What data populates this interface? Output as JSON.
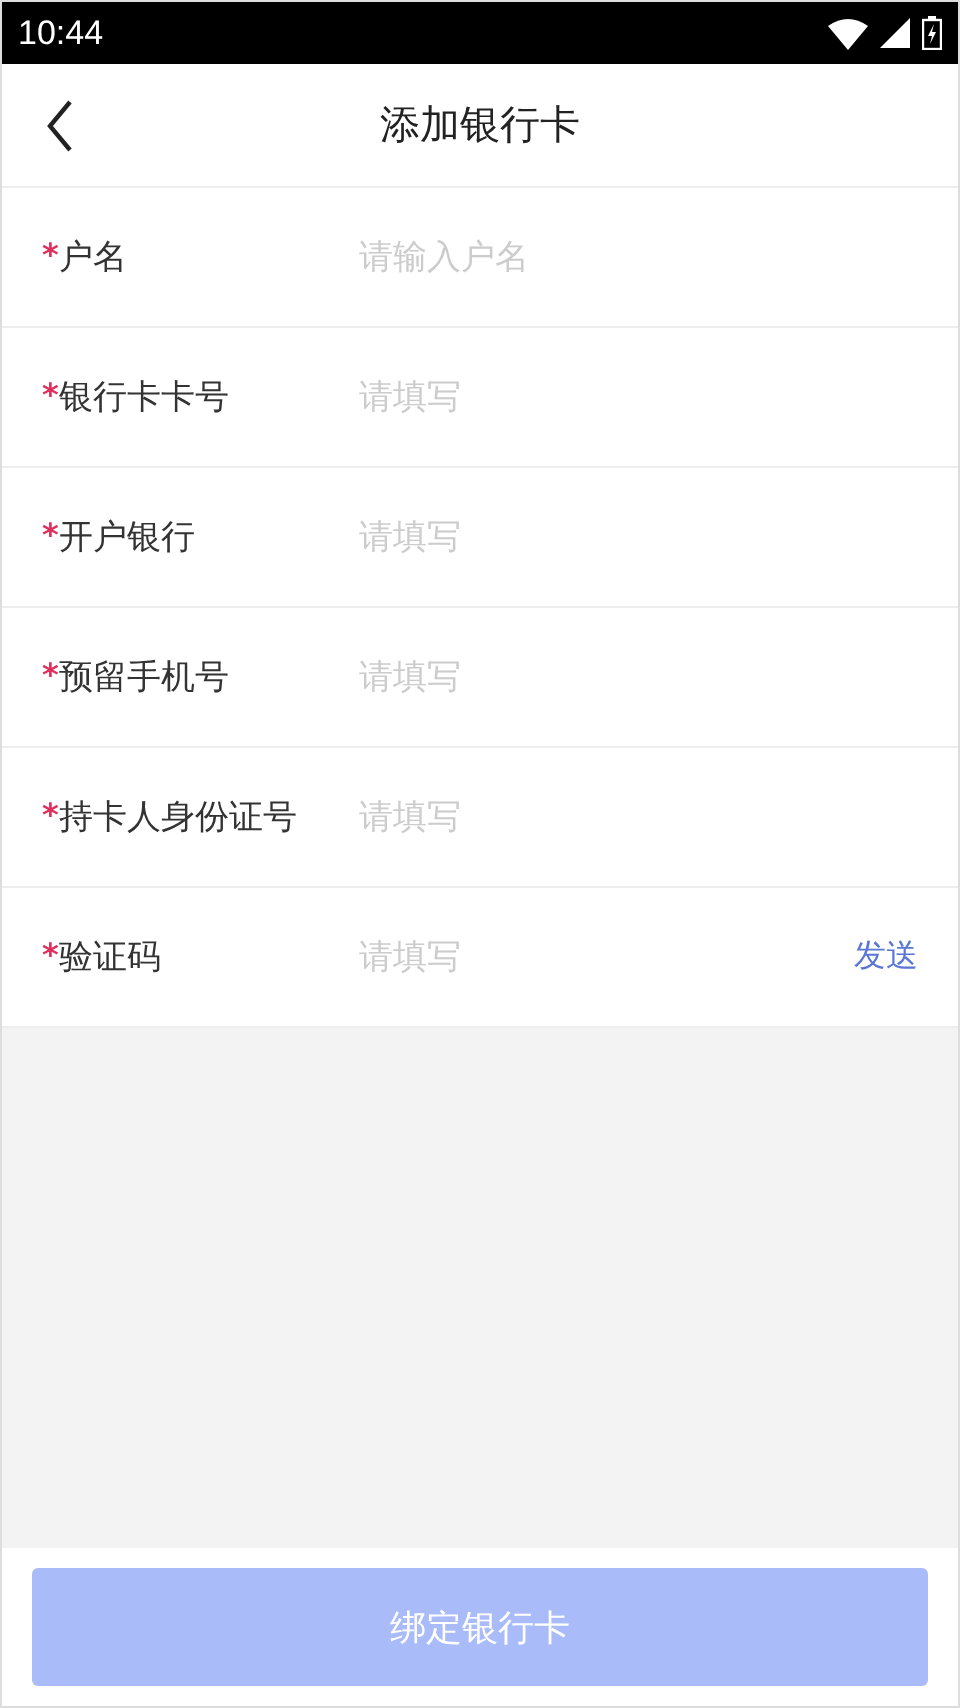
{
  "status_bar": {
    "time": "10:44"
  },
  "header": {
    "title": "添加银行卡"
  },
  "fields": [
    {
      "mark": "*",
      "label": "户名",
      "placeholder": "请输入户名"
    },
    {
      "mark": "*",
      "label": "银行卡卡号",
      "placeholder": "请填写"
    },
    {
      "mark": "*",
      "label": "开户银行",
      "placeholder": "请填写"
    },
    {
      "mark": "*",
      "label": "预留手机号",
      "placeholder": "请填写"
    },
    {
      "mark": "*",
      "label": "持卡人身份证号",
      "placeholder": "请填写"
    },
    {
      "mark": "*",
      "label": "验证码",
      "placeholder": "请填写",
      "action": "发送"
    }
  ],
  "submit": {
    "label": "绑定银行卡",
    "disabled": true
  }
}
